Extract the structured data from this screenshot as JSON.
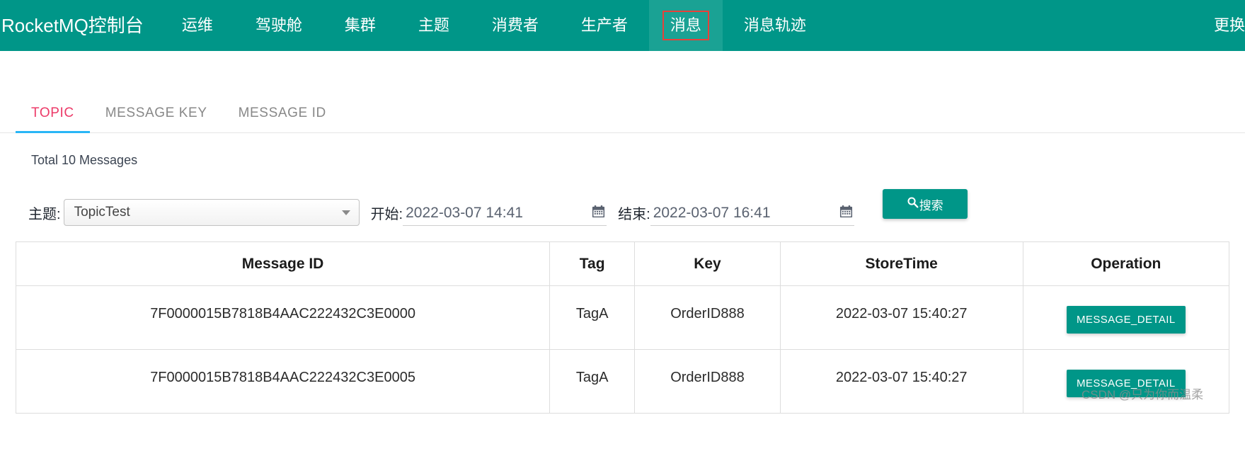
{
  "header": {
    "brand": "RocketMQ控制台",
    "nav_items": [
      {
        "label": "运维"
      },
      {
        "label": "驾驶舱"
      },
      {
        "label": "集群"
      },
      {
        "label": "主题"
      },
      {
        "label": "消费者"
      },
      {
        "label": "生产者"
      },
      {
        "label": "消息",
        "active": true,
        "annotated": true
      },
      {
        "label": "消息轨迹"
      }
    ],
    "right_label": "更换",
    "bg_color": "#009688",
    "active_bg_color": "#1aa294",
    "annotation_color": "#e8413a"
  },
  "tabs": [
    {
      "label": "TOPIC",
      "active": true
    },
    {
      "label": "MESSAGE KEY",
      "active": false
    },
    {
      "label": "MESSAGE ID",
      "active": false
    }
  ],
  "tab_active_color": "#ec3a68",
  "tab_underline_color": "#29b6f6",
  "status": {
    "total_text": "Total 10 Messages"
  },
  "filters": {
    "topic_label": "主题:",
    "topic_value": "TopicTest",
    "start_label": "开始:",
    "start_value": "2022-03-07 14:41",
    "end_label": "结束:",
    "end_value": "2022-03-07 16:41",
    "search_label": "搜索",
    "search_icon": "magnifier-icon",
    "calendar_icon": "calendar-icon",
    "button_color": "#009688"
  },
  "table": {
    "columns": [
      "Message ID",
      "Tag",
      "Key",
      "StoreTime",
      "Operation"
    ],
    "rows": [
      {
        "message_id": "7F0000015B7818B4AAC222432C3E0000",
        "tag": "TagA",
        "key": "OrderID888",
        "store_time": "2022-03-07 15:40:27",
        "operation_label": "MESSAGE_DETAIL"
      },
      {
        "message_id": "7F0000015B7818B4AAC222432C3E0005",
        "tag": "TagA",
        "key": "OrderID888",
        "store_time": "2022-03-07 15:40:27",
        "operation_label": "MESSAGE_DETAIL"
      }
    ]
  },
  "watermark": {
    "text": "CSDN @只为你而温柔"
  }
}
